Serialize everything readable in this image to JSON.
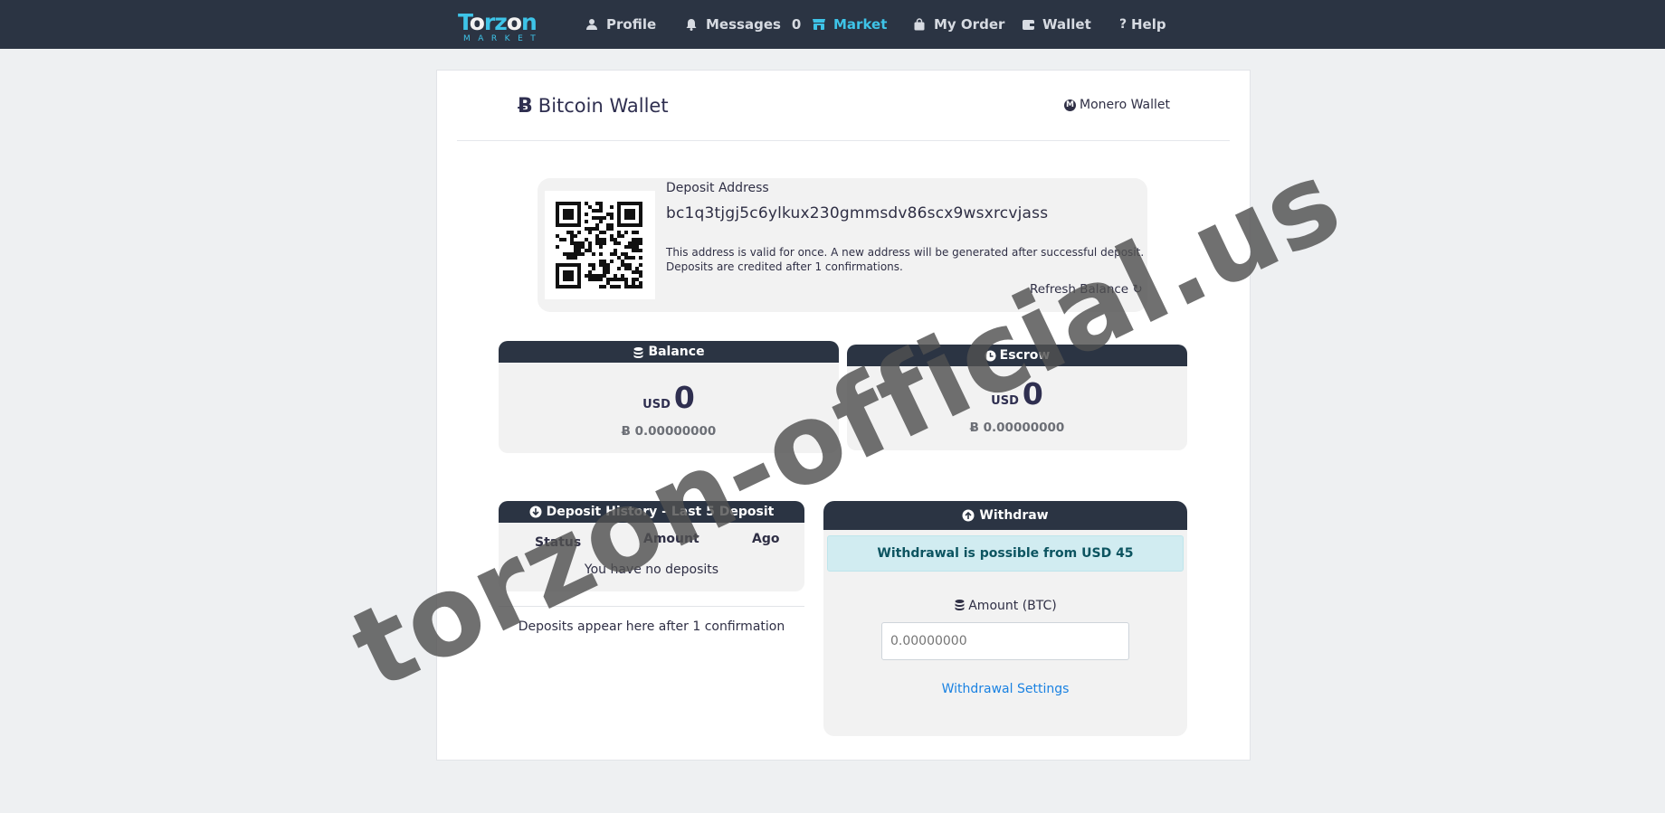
{
  "navbar": {
    "logo": {
      "line1_a": "T",
      "line1_b": "o",
      "line1_c": "rz",
      "line1_d": "o",
      "line1_e": "n",
      "line2": "MARKET"
    },
    "items": [
      {
        "label": "Profile",
        "icon": "user-icon"
      },
      {
        "label": "Messages",
        "icon": "bell-icon",
        "count": "0"
      },
      {
        "label": "Market",
        "icon": "store-icon",
        "active": true
      },
      {
        "label": "My Order",
        "icon": "bag-icon"
      },
      {
        "label": "Wallet",
        "icon": "wallet-icon"
      },
      {
        "label": "Help",
        "icon": "question-icon"
      }
    ],
    "colors": {
      "background": "#2b3443",
      "accent": "#3ec4e8"
    }
  },
  "wallet": {
    "title": "Bitcoin Wallet",
    "btc_symbol": "Ƀ",
    "monero_link": "Monero Wallet"
  },
  "deposit": {
    "label": "Deposit Address",
    "address": "bc1q3tjgj5c6ylkux230gmmsdv86scx9wsxrcvjass",
    "note_line1": "This address is valid for once. A new address will be generated after successful deposit.",
    "note_line2": "Deposits are credited after 1 confirmations.",
    "refresh": "Refresh Balance ↻"
  },
  "balance": {
    "title": "Balance",
    "currency": "USD",
    "usd_amount": "0",
    "btc_amount": "Ƀ 0.00000000"
  },
  "escrow": {
    "title": "Escrow",
    "currency": "USD",
    "usd_amount": "0",
    "btc_amount": "Ƀ 0.00000000"
  },
  "history": {
    "title": "Deposit History - Last 5 Deposit",
    "columns": [
      "Status",
      "Amount",
      "Ago"
    ],
    "empty": "You have no deposits",
    "footer": "Deposits appear here after 1 confirmation"
  },
  "withdraw": {
    "title": "Withdraw",
    "alert": "Withdrawal is possible from USD 45",
    "amount_label": "Amount (BTC)",
    "amount_placeholder": "0.00000000",
    "settings_link": "Withdrawal Settings",
    "colors": {
      "alert_bg": "#d1ecf1",
      "alert_text": "#0c5460",
      "link": "#1a82e2"
    }
  },
  "watermark": "torzon-official.us"
}
